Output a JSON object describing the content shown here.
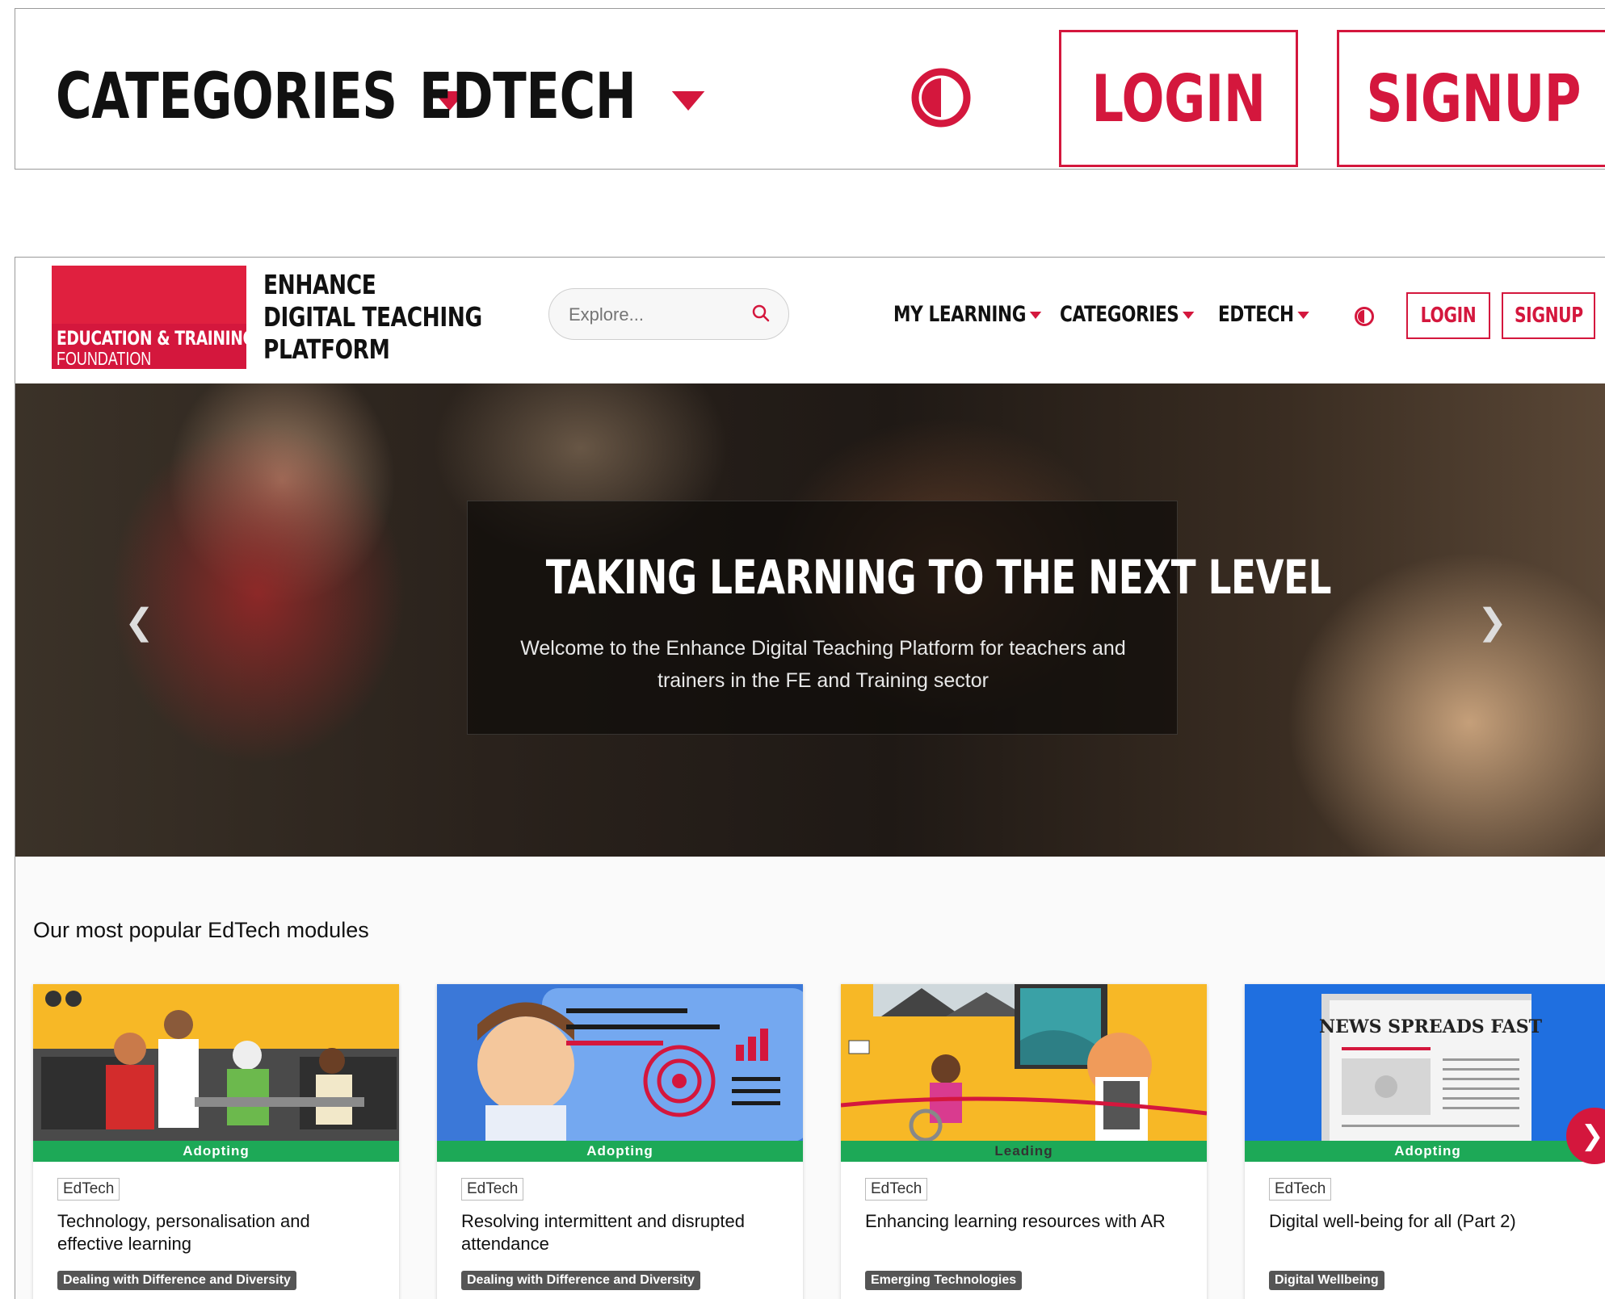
{
  "zoom_header": {
    "categories_label": "CATEGORIES",
    "edtech_label": "EDTECH",
    "login_label": "LOGIN",
    "signup_label": "SIGNUP"
  },
  "site": {
    "logo": {
      "line1": "EDUCATION & TRAINING",
      "line2": "FOUNDATION"
    },
    "platform_name": [
      "ENHANCE",
      "DIGITAL TEACHING",
      "PLATFORM"
    ],
    "search": {
      "placeholder": "Explore..."
    },
    "nav": {
      "my_learning": "MY LEARNING",
      "categories": "CATEGORIES",
      "edtech": "EDTECH",
      "login": "LOGIN",
      "signup": "SIGNUP"
    }
  },
  "hero": {
    "title": "TAKING LEARNING TO THE NEXT LEVEL",
    "subtitle_line1": "Welcome to the Enhance Digital Teaching Platform for teachers and",
    "subtitle_line2": "trainers in the FE and Training sector",
    "prev_icon": "chevron-left-icon",
    "next_icon": "chevron-right-icon"
  },
  "popular": {
    "heading": "Our most popular EdTech modules",
    "cards": [
      {
        "level": "Adopting",
        "tag": "EdTech",
        "title": "Technology, personalisation and effective learning",
        "category": "Dealing with Difference and Diversity"
      },
      {
        "level": "Adopting",
        "tag": "EdTech",
        "title": "Resolving intermittent and disrupted attendance",
        "category": "Dealing with Difference and Diversity"
      },
      {
        "level": "Leading",
        "tag": "EdTech",
        "title": "Enhancing learning resources with AR",
        "category": "Emerging Technologies"
      },
      {
        "level": "Adopting",
        "tag": "EdTech",
        "title": "Digital well-being for all (Part 2)",
        "category": "Digital Wellbeing",
        "image_text": "NEWS SPREADS FAST"
      }
    ]
  },
  "colors": {
    "brand": "#d4173d",
    "level_bar": "#1da957"
  }
}
